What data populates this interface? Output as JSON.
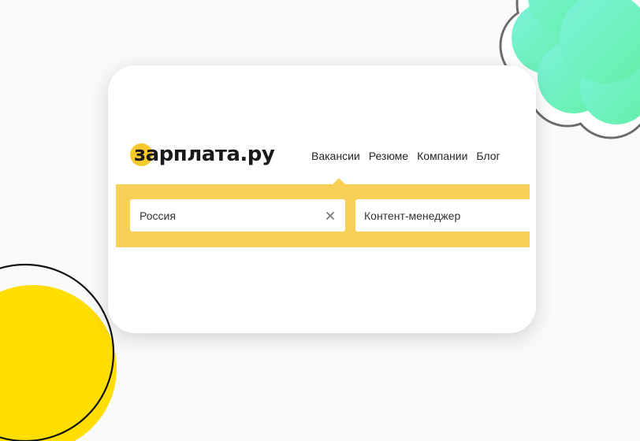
{
  "logo": {
    "text": "зарплата.ру",
    "accent_color": "#f7c92d"
  },
  "nav": {
    "items": [
      {
        "label": "Вакансии"
      },
      {
        "label": "Резюме"
      },
      {
        "label": "Компании"
      },
      {
        "label": "Блог"
      }
    ]
  },
  "search": {
    "location_value": "Россия",
    "query_value": "Контент-менеджер",
    "band_color": "#f7d056"
  },
  "icons": {
    "clear": "close-icon",
    "active_tab_marker": "caret-up-icon"
  },
  "decor": {
    "cloud_color": "#6ff0c8",
    "circle_color": "#ffde00"
  }
}
